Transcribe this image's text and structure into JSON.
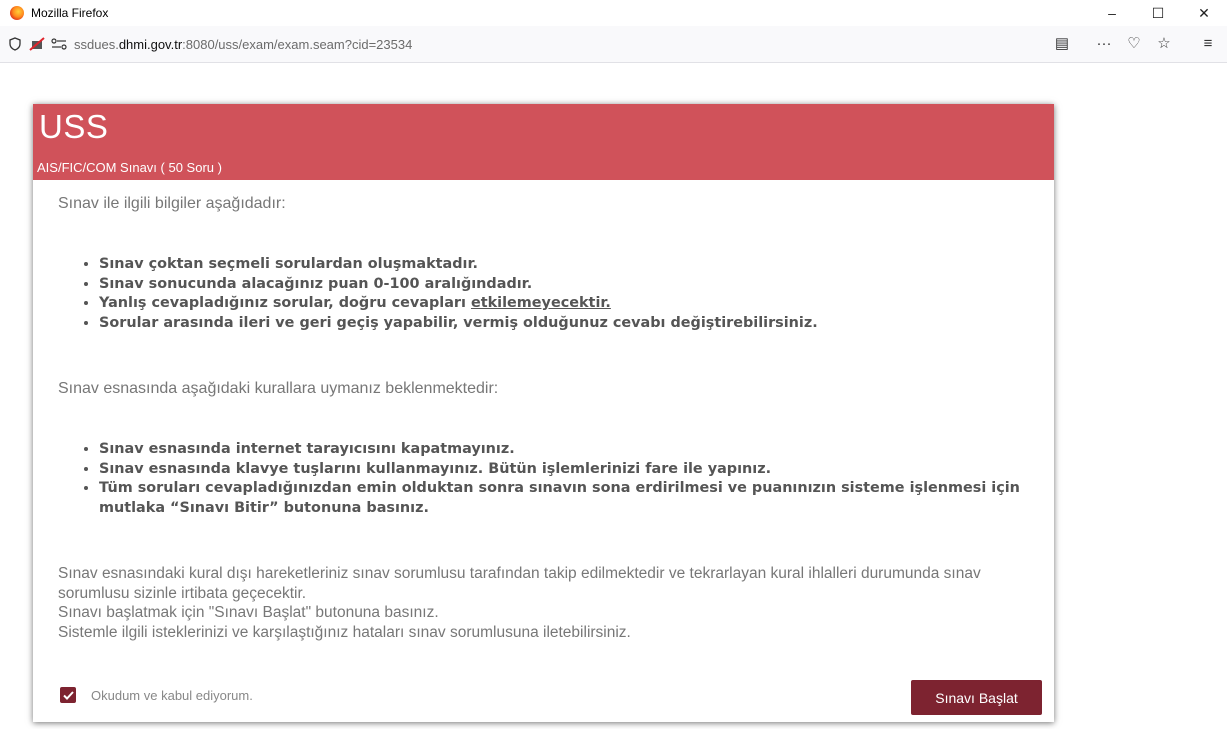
{
  "window": {
    "title": "Mozilla Firefox",
    "minimize": "–",
    "maximize": "☐",
    "close": "✕"
  },
  "navbar": {
    "url_prefix": "ssdues.",
    "url_host": "dhmi.gov.tr",
    "url_suffix": ":8080/uss/exam/exam.seam?cid=23534",
    "shield": "⛉",
    "reader": "▤",
    "more": "···",
    "pocket": "♡",
    "bookmark": "☆",
    "menu": "≡"
  },
  "card": {
    "title": "USS",
    "subtitle": "AIS/FIC/COM Sınavı ( 50 Soru )",
    "intro1": "Sınav ile ilgili bilgiler aşağıdadır:",
    "rules1": [
      "Sınav çoktan seçmeli sorulardan oluşmaktadır.",
      "Sınav sonucunda alacağınız puan 0-100 aralığındadır.",
      "Yanlış cevapladığınız sorular, doğru cevapları ",
      "Sorular arasında ileri ve geri geçiş yapabilir, vermiş olduğunuz cevabı değiştirebilirsiniz."
    ],
    "rules1_underlined": "etkilemeyecektir.",
    "intro2": "Sınav esnasında aşağıdaki kurallara uymanız beklenmektedir:",
    "rules2": [
      "Sınav esnasında internet tarayıcısını kapatmayınız.",
      "Sınav esnasında klavye tuşlarını kullanmayınız. Bütün işlemlerinizi fare ile yapınız.",
      "Tüm soruları cevapladığınızdan emin olduktan sonra sınavın sona erdirilmesi ve puanınızın sisteme işlenmesi için mutlaka “Sınavı Bitir” butonuna basınız."
    ],
    "footer": [
      "Sınav esnasındaki kural dışı hareketleriniz sınav sorumlusu tarafından takip edilmektedir ve tekrarlayan kural ihlalleri durumunda sınav sorumlusu sizinle irtibata geçecektir.",
      "Sınavı başlatmak için \"Sınavı Başlat\" butonuna basınız.",
      "Sistemle ilgili isteklerinizi ve karşılaştığınız hataları sınav sorumlusuna iletebilirsiniz."
    ],
    "accept_label": "Okudum ve kabul ediyorum.",
    "accept_checked": true,
    "start_button": "Sınavı Başlat"
  },
  "colors": {
    "header": "#d0525a",
    "accent": "#7d2330"
  }
}
